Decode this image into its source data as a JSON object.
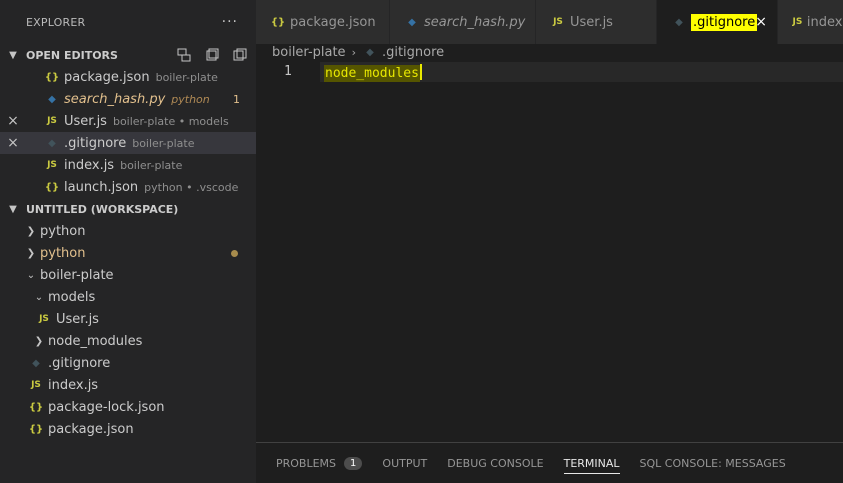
{
  "explorer": {
    "title": "EXPLORER",
    "more": "···"
  },
  "open_editors": {
    "header": "OPEN EDITORS",
    "items": [
      {
        "icon": "{}",
        "name": "package.json",
        "desc": "boiler-plate",
        "close": ""
      },
      {
        "icon": "py",
        "name": "search_hash.py",
        "desc": "python",
        "count": "1"
      },
      {
        "icon": "JS",
        "name": "User.js",
        "desc": "boiler-plate • models",
        "close": "×"
      },
      {
        "icon": "git",
        "name": ".gitignore",
        "desc": "boiler-plate",
        "close": "×"
      },
      {
        "icon": "JS",
        "name": "index.js",
        "desc": "boiler-plate"
      },
      {
        "icon": "{}",
        "name": "launch.json",
        "desc": "python • .vscode"
      }
    ]
  },
  "workspace": {
    "header": "UNTITLED (WORKSPACE)",
    "tree": [
      {
        "name": "python"
      },
      {
        "name": "python"
      },
      {
        "name": "boiler-plate"
      },
      {
        "name": "models"
      },
      {
        "name": "User.js"
      },
      {
        "name": "node_modules"
      },
      {
        "name": ".gitignore"
      },
      {
        "name": "index.js"
      },
      {
        "name": "package-lock.json"
      },
      {
        "name": "package.json"
      }
    ]
  },
  "tabs": [
    {
      "label": "package.json"
    },
    {
      "label": "search_hash.py"
    },
    {
      "label": "User.js"
    },
    {
      "label": ".gitignore",
      "close": "×"
    },
    {
      "label": "index.js"
    }
  ],
  "breadcrumb": {
    "folder": "boiler-plate",
    "sep": "›",
    "file": ".gitignore"
  },
  "editor": {
    "line_number": "1",
    "code": "node_modules"
  },
  "panel": {
    "tabs": [
      {
        "label": "PROBLEMS",
        "badge": "1"
      },
      {
        "label": "OUTPUT"
      },
      {
        "label": "DEBUG CONSOLE"
      },
      {
        "label": "TERMINAL"
      },
      {
        "label": "SQL CONSOLE: MESSAGES"
      }
    ]
  },
  "icons": {
    "json": "{}",
    "js": "JS",
    "python": "python-icon",
    "git": "git-diamond-icon"
  },
  "colors": {
    "modified": "#e2c08d",
    "highlight": "#ffff00",
    "background": "#1e1e1e",
    "sidebar": "#252526"
  }
}
